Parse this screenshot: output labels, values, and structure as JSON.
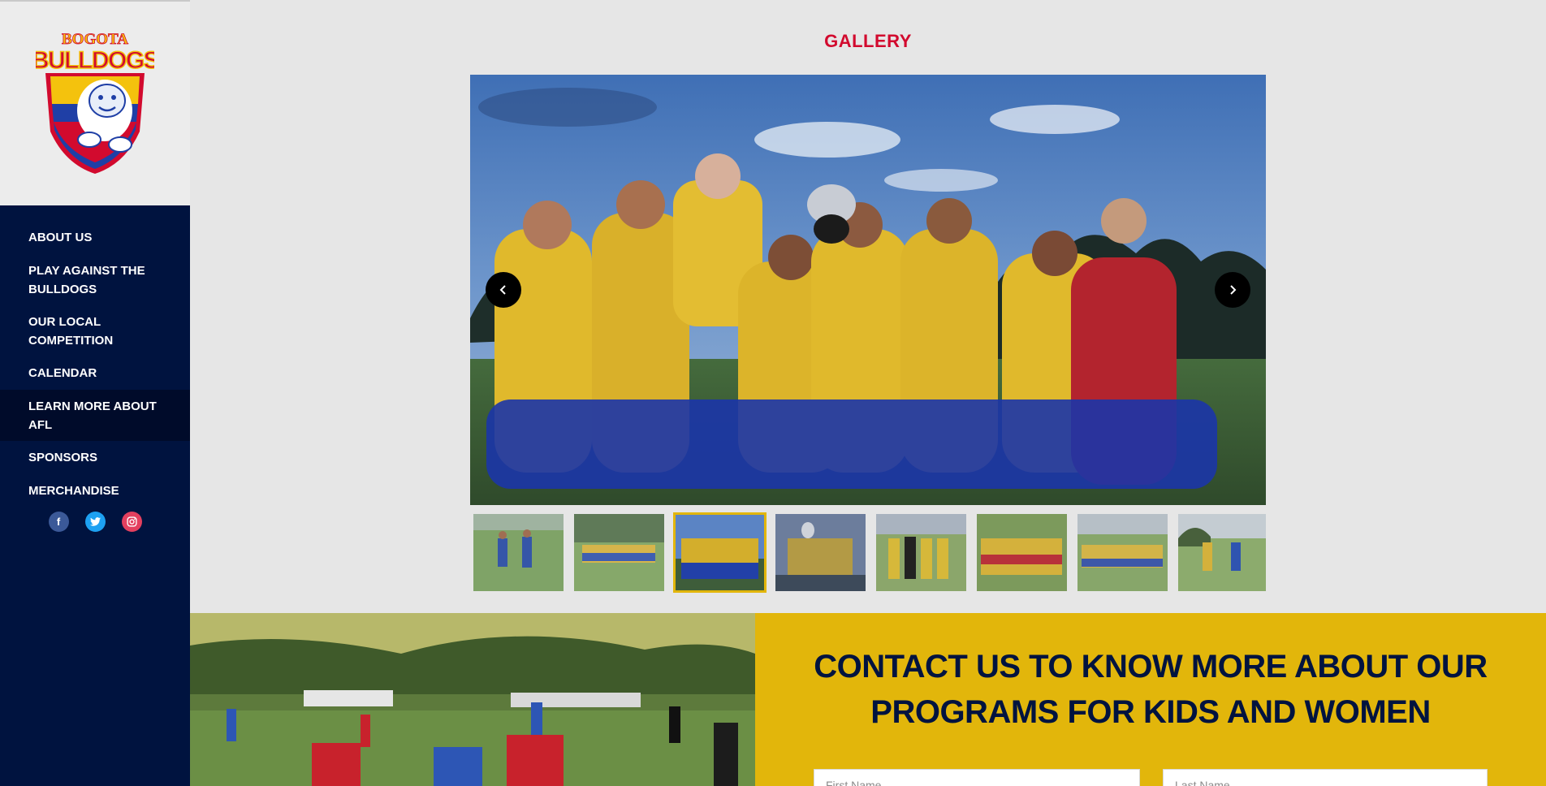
{
  "brand": {
    "logo_line1": "BOGOTA",
    "logo_line2": "BULLDOGS"
  },
  "nav": {
    "items": [
      {
        "label": "ABOUT US"
      },
      {
        "label": "PLAY AGAINST THE BULLDOGS"
      },
      {
        "label": "OUR LOCAL COMPETITION"
      },
      {
        "label": "CALENDAR"
      },
      {
        "label": "LEARN MORE ABOUT AFL"
      },
      {
        "label": "SPONSORS"
      },
      {
        "label": "MERCHANDISE"
      }
    ],
    "active_item": "LEARN MORE ABOUT AFL"
  },
  "social": [
    {
      "icon": "facebook-icon",
      "glyph": "f",
      "color": "#3b5998"
    },
    {
      "icon": "twitter-icon",
      "glyph": "t",
      "color": "#1da1f2"
    },
    {
      "icon": "instagram-icon",
      "glyph": "◎",
      "color": "#e4405f"
    }
  ],
  "gallery": {
    "title": "GALLERY",
    "prev_icon": "chevron-left-icon",
    "next_icon": "chevron-right-icon",
    "thumbnail_count": 8,
    "selected_thumbnail": 3
  },
  "contact": {
    "heading": "CONTACT US TO KNOW MORE ABOUT OUR PROGRAMS FOR KIDS AND WOMEN",
    "first_name_placeholder": "First Name",
    "last_name_placeholder": "Last Name"
  },
  "colors": {
    "navy": "#00133f",
    "brand_red": "#d20a2e",
    "brand_yellow": "#e2b60b",
    "page_bg": "#e6e6e6"
  }
}
